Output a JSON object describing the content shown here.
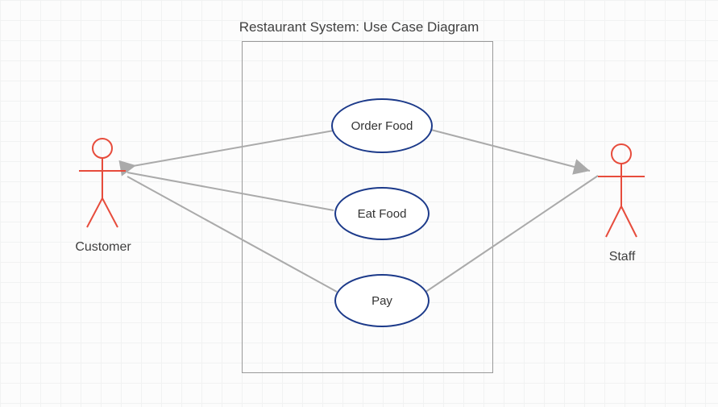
{
  "diagram": {
    "title": "Restaurant  System: Use Case Diagram",
    "system_name": "Restaurant System",
    "actors": {
      "left": {
        "label": "Customer"
      },
      "right": {
        "label": "Staff"
      }
    },
    "usecases": {
      "top": {
        "label": "Order Food"
      },
      "middle": {
        "label": "Eat Food"
      },
      "bottom": {
        "label": "Pay"
      }
    },
    "relations": [
      {
        "from": "Order Food",
        "to": "Customer",
        "type": "arrow"
      },
      {
        "from": "Eat Food",
        "to": "Customer",
        "type": "line"
      },
      {
        "from": "Pay",
        "to": "Customer",
        "type": "line"
      },
      {
        "from": "Order Food",
        "to": "Staff",
        "type": "arrow"
      },
      {
        "from": "Pay",
        "to": "Staff",
        "type": "line"
      }
    ]
  }
}
